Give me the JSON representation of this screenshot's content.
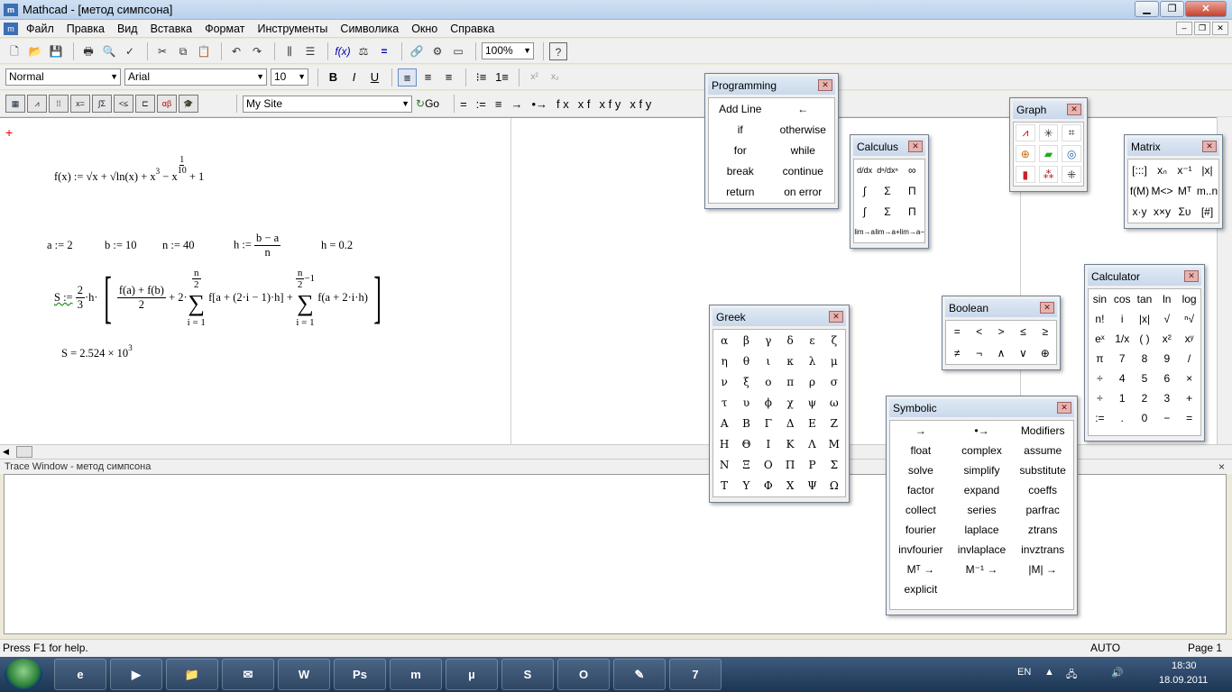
{
  "window": {
    "title": "Mathcad - [метод симпсона]",
    "app_icon": "mathcad-icon"
  },
  "menu": [
    "Файл",
    "Правка",
    "Вид",
    "Вставка",
    "Формат",
    "Инструменты",
    "Символика",
    "Окно",
    "Справка"
  ],
  "toolbar1": {
    "zoom": "100%"
  },
  "toolbar2": {
    "style": "Normal",
    "font": "Arial",
    "size": "10",
    "bold": "B",
    "italic": "I",
    "underline": "U"
  },
  "toolbar3": {
    "site": "My Site",
    "go": "Go",
    "ops": [
      "=",
      ":=",
      "≡",
      "→",
      "•→",
      "f x",
      "x f",
      "x f y",
      "x f y"
    ]
  },
  "worksheet": {
    "f_def": {
      "lhs": "f(x) :=",
      "body": "√x + √ln(x) + x",
      "exp1": "3",
      "minus": "− x",
      "exp_num": "1",
      "exp_den": "10",
      "tail": "+ 1"
    },
    "a": "a := 2",
    "b": "b := 10",
    "n": "n := 40",
    "h_lhs": "h :=",
    "h_num": "b − a",
    "h_den": "n",
    "h_val": "h = 0.2",
    "S_lhs": "S :=",
    "S_coef_num": "2",
    "S_coef_den": "3",
    "S_h": "·h·",
    "S_frac_num": "f(a) + f(b)",
    "S_frac_den": "2",
    "S_plus2": "+ 2·",
    "sum1_top_num": "n",
    "sum1_top_den": "2",
    "sum1_bot": "i = 1",
    "sum1_body": "f[a + (2·i − 1)·h] +",
    "sum2_top_num": "n",
    "sum2_top_den": "2",
    "sum2_top_minus": "−1",
    "sum2_bot": "i = 1",
    "sum2_body": "f(a + 2·i·h)",
    "S_result": "S = 2.524 × 10",
    "S_result_exp": "3"
  },
  "trace": {
    "title": "Trace Window - метод симпсона",
    "close": "×"
  },
  "status": {
    "help": "Press F1 for help.",
    "mode": "AUTO",
    "page": "Page 1"
  },
  "taskbar": {
    "lang": "EN",
    "time": "18:30",
    "date": "18.09.2011"
  },
  "programming": {
    "title": "Programming",
    "items": [
      "Add Line",
      "←",
      "if",
      "otherwise",
      "for",
      "while",
      "break",
      "continue",
      "return",
      "on error"
    ]
  },
  "calculus": {
    "title": "Calculus",
    "items": [
      "d/dx",
      "dⁿ/dxⁿ",
      "∞",
      "∫",
      "Σ",
      "Π",
      "∫",
      "Σ",
      "Π",
      "lim→a",
      "lim→a+",
      "lim→a−"
    ]
  },
  "graph": {
    "title": "Graph",
    "items": [
      "X-Y",
      "Polar",
      "3D",
      "Contour",
      "Surface",
      "Vector",
      "Bar",
      "Scatter",
      "Patch"
    ]
  },
  "matrix": {
    "title": "Matrix",
    "items": [
      "[:::]",
      "xₙ",
      "x⁻¹",
      "|x|",
      "f(M)",
      "M<>",
      "Mᵀ",
      "m..n",
      "x·y",
      "x×y",
      "Συ",
      "[#]"
    ]
  },
  "calculator": {
    "title": "Calculator",
    "items": [
      "sin",
      "cos",
      "tan",
      "ln",
      "log",
      "n!",
      "i",
      "|x|",
      "√",
      "ⁿ√",
      "eˣ",
      "1/x",
      "( )",
      "x²",
      "xʸ",
      "π",
      "7",
      "8",
      "9",
      "/",
      "÷",
      "4",
      "5",
      "6",
      "×",
      "÷",
      "1",
      "2",
      "3",
      "+",
      ":=",
      ".",
      "0",
      "−",
      "="
    ]
  },
  "boolean": {
    "title": "Boolean",
    "items": [
      "=",
      "<",
      ">",
      "≤",
      "≥",
      "≠",
      "¬",
      "∧",
      "∨",
      "⊕"
    ]
  },
  "greek": {
    "title": "Greek",
    "items": [
      "α",
      "β",
      "γ",
      "δ",
      "ε",
      "ζ",
      "η",
      "θ",
      "ι",
      "κ",
      "λ",
      "μ",
      "ν",
      "ξ",
      "ο",
      "π",
      "ρ",
      "σ",
      "τ",
      "υ",
      "ϕ",
      "χ",
      "ψ",
      "ω",
      "Α",
      "Β",
      "Γ",
      "Δ",
      "Ε",
      "Ζ",
      "Η",
      "Θ",
      "Ι",
      "Κ",
      "Λ",
      "Μ",
      "Ν",
      "Ξ",
      "Ο",
      "Π",
      "Ρ",
      "Σ",
      "Τ",
      "Υ",
      "Φ",
      "Χ",
      "Ψ",
      "Ω"
    ]
  },
  "symbolic": {
    "title": "Symbolic",
    "items": [
      "→",
      "•→",
      "Modifiers",
      "float",
      "complex",
      "assume",
      "solve",
      "simplify",
      "substitute",
      "factor",
      "expand",
      "coeffs",
      "collect",
      "series",
      "parfrac",
      "fourier",
      "laplace",
      "ztrans",
      "invfourier",
      "invlaplace",
      "invztrans",
      "Mᵀ →",
      "M⁻¹ →",
      "|M| →",
      "explicit",
      "",
      ""
    ]
  }
}
